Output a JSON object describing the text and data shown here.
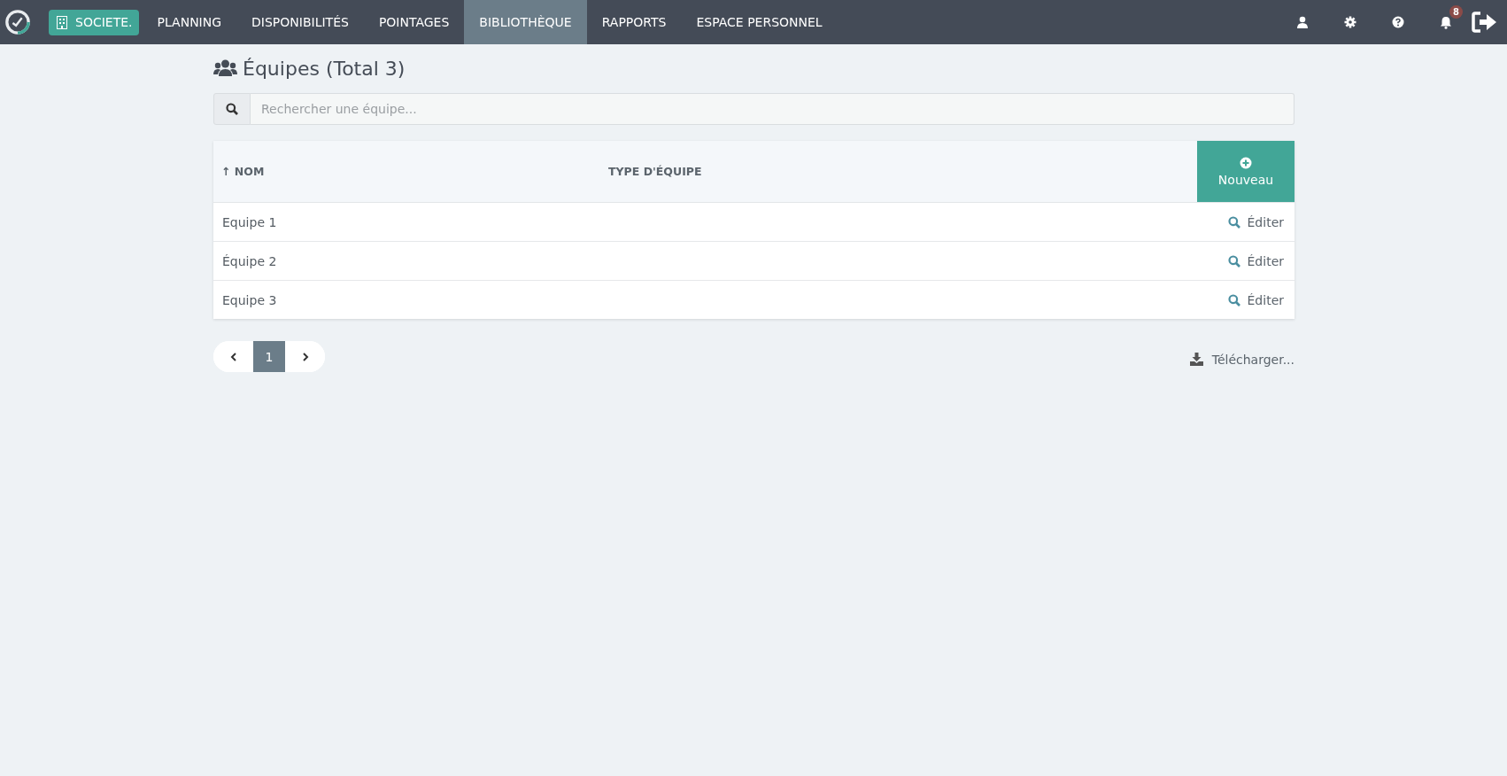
{
  "navbar": {
    "company": "SOCIETE.",
    "items": [
      {
        "label": "PLANNING",
        "selected": false
      },
      {
        "label": "DISPONIBILITÉS",
        "selected": false
      },
      {
        "label": "POINTAGES",
        "selected": false
      },
      {
        "label": "BIBLIOTHÈQUE",
        "selected": true
      },
      {
        "label": "RAPPORTS",
        "selected": false
      },
      {
        "label": "ESPACE PERSONNEL",
        "selected": false
      }
    ],
    "notification_count": "8"
  },
  "title": "Équipes (Total 3)",
  "search": {
    "placeholder": "Rechercher une équipe..."
  },
  "table": {
    "columns": [
      {
        "label": "NOM",
        "sort_arrow": "↑"
      },
      {
        "label": "TYPE D'ÉQUIPE"
      }
    ],
    "new_button": "Nouveau",
    "rows": [
      {
        "name": "Equipe 1",
        "action": "Éditer"
      },
      {
        "name": "Équipe 2",
        "action": "Éditer"
      },
      {
        "name": "Equipe 3",
        "action": "Éditer"
      }
    ]
  },
  "pagination": {
    "pages": [
      {
        "label": "1",
        "selected": true
      }
    ]
  },
  "download": "Télécharger..."
}
